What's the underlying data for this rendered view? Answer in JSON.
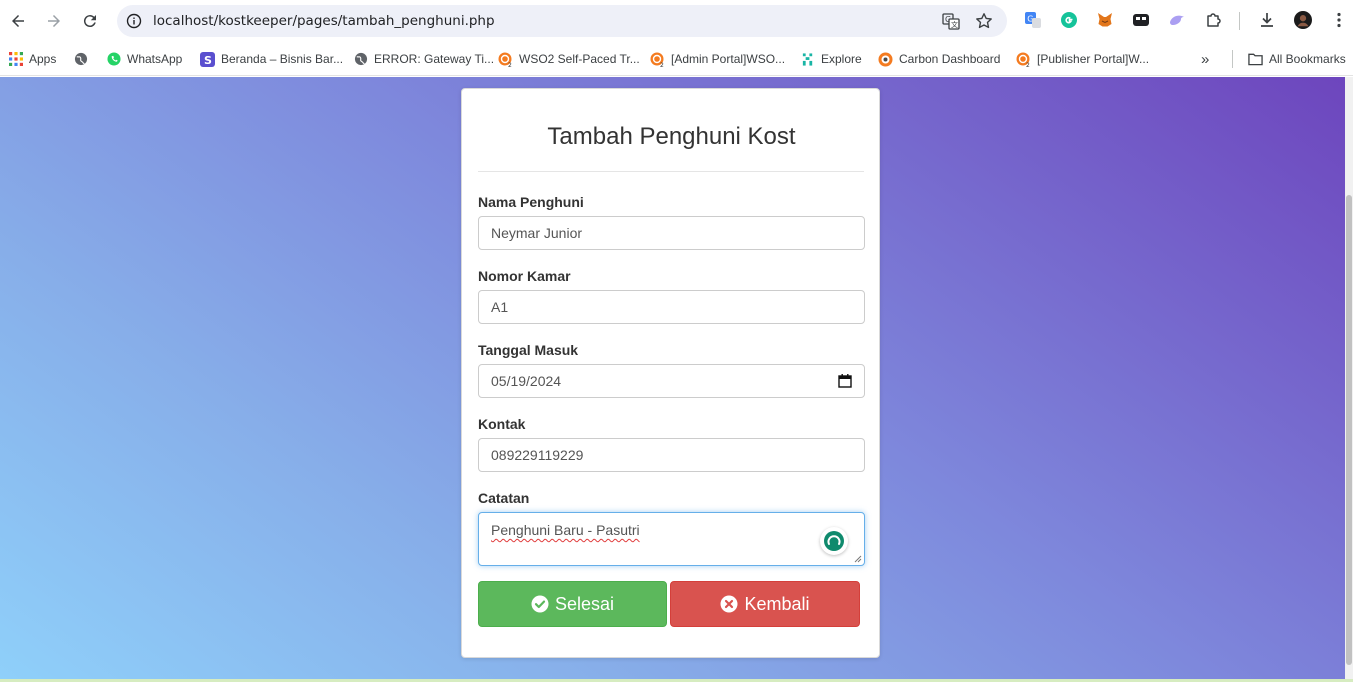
{
  "browser": {
    "url": "localhost/kostkeeper/pages/tambah_penghuni.php",
    "bookmarks": [
      {
        "label": "Apps",
        "icon": "apps-grid-icon"
      },
      {
        "label": "",
        "icon": "globe-icon"
      },
      {
        "label": "WhatsApp",
        "icon": "whatsapp-icon"
      },
      {
        "label": "Beranda – Bisnis Bar...",
        "icon": "s-logo-icon"
      },
      {
        "label": "ERROR: Gateway Ti...",
        "icon": "globe-icon"
      },
      {
        "label": "WSO2 Self-Paced Tr...",
        "icon": "wso2-icon"
      },
      {
        "label": "[Admin Portal]WSO...",
        "icon": "wso2-icon"
      },
      {
        "label": "Explore",
        "icon": "explore-icon"
      },
      {
        "label": "Carbon Dashboard",
        "icon": "carbon-icon"
      },
      {
        "label": "[Publisher Portal]W...",
        "icon": "wso2-icon"
      },
      {
        "label": "All Bookmarks",
        "icon": "folder-icon"
      }
    ],
    "more_label": "»"
  },
  "form": {
    "title": "Tambah Penghuni Kost",
    "fields": [
      {
        "label": "Nama Penghuni",
        "value": "Neymar Junior"
      },
      {
        "label": "Nomor Kamar",
        "value": "A1"
      },
      {
        "label": "Tanggal Masuk",
        "value": "05/19/2024"
      },
      {
        "label": "Kontak",
        "value": "089229119229"
      },
      {
        "label": "Catatan",
        "value": "Penghuni Baru - Pasutri"
      }
    ],
    "submit_label": "Selesai",
    "back_label": "Kembali"
  },
  "colors": {
    "success": "#5cb85c",
    "danger": "#d9534f",
    "gradient_start": "#8fd0fa",
    "gradient_end": "#6d45bd"
  }
}
